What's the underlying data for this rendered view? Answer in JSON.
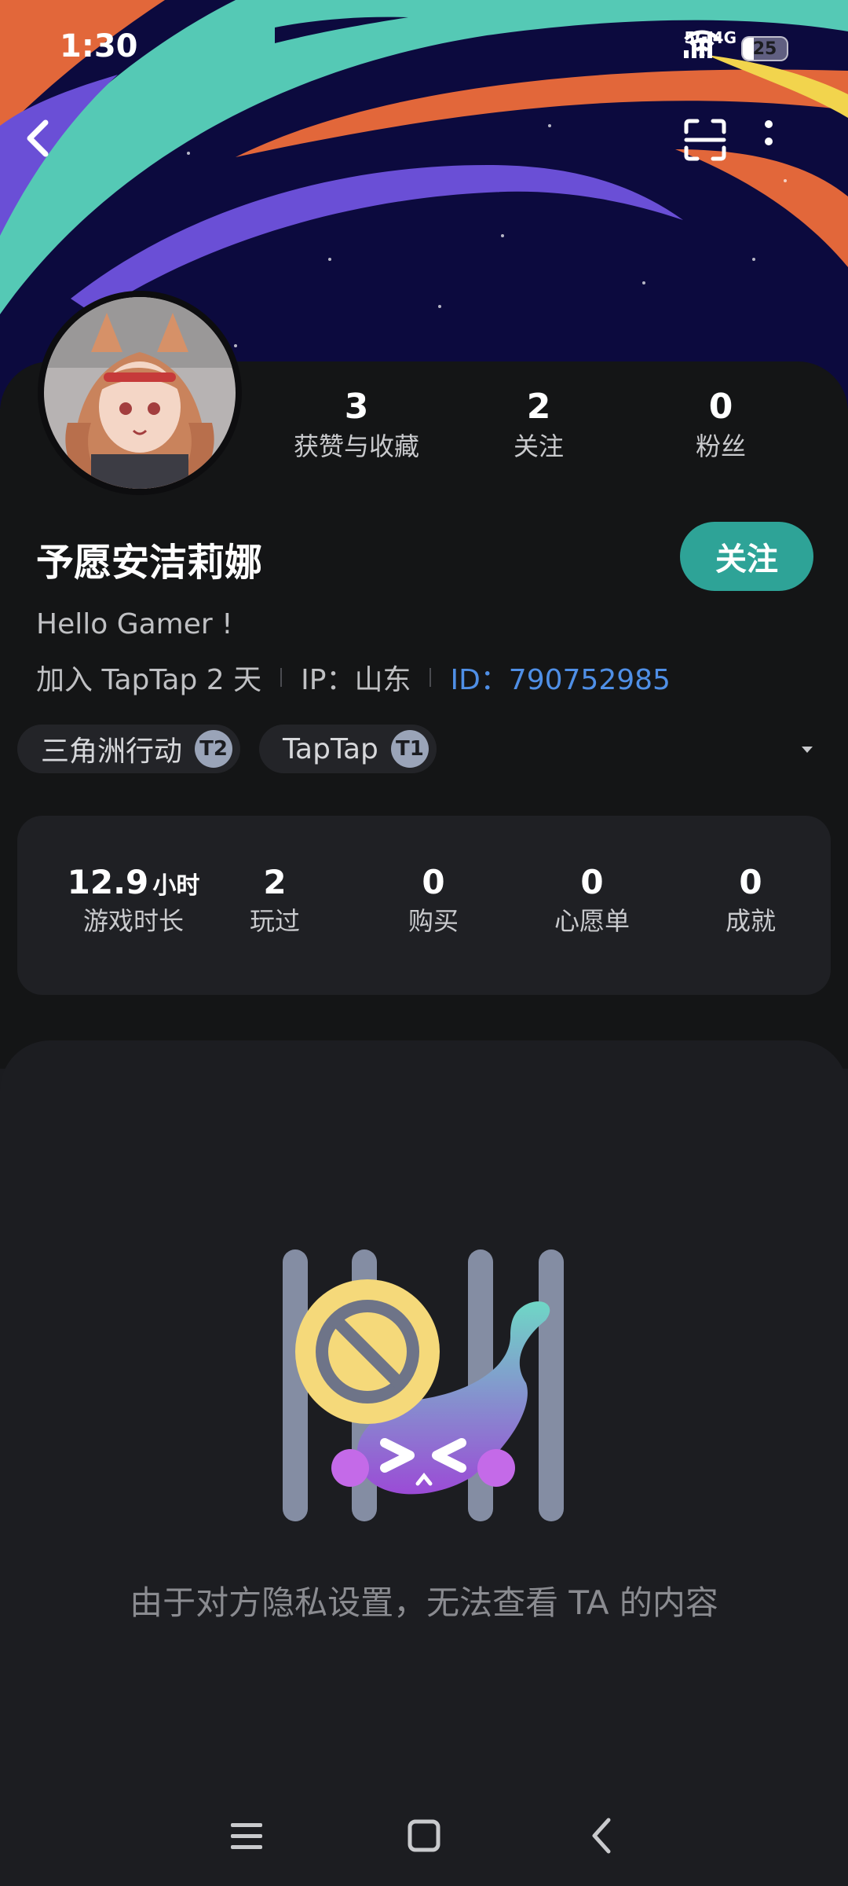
{
  "status_bar": {
    "time": "1:30",
    "network_1": "5G",
    "network_2": "4G",
    "battery": "25",
    "battery_level": 0.25
  },
  "nav": {
    "back_icon": "chevron-left-icon",
    "scan_icon": "scan-icon",
    "more_icon": "more-vertical-icon"
  },
  "profile": {
    "name": "予愿安洁莉娜",
    "follow_label": "关注",
    "bio": "Hello Gamer !",
    "joined": "加入 TapTap 2 天",
    "ip": "IP：山东",
    "id": "ID：790752985",
    "stats": [
      {
        "value": "3",
        "label": "获赞与收藏"
      },
      {
        "value": "2",
        "label": "关注"
      },
      {
        "value": "0",
        "label": "粉丝"
      }
    ],
    "tags": [
      {
        "label": "三角洲行动",
        "badge": "T2"
      },
      {
        "label": "TapTap",
        "badge": "T1"
      }
    ]
  },
  "game_stats": [
    {
      "value": "12.9",
      "unit": "小时",
      "label": "游戏时长"
    },
    {
      "value": "2",
      "unit": "",
      "label": "玩过"
    },
    {
      "value": "0",
      "unit": "",
      "label": "购买"
    },
    {
      "value": "0",
      "unit": "",
      "label": "心愿单"
    },
    {
      "value": "0",
      "unit": "",
      "label": "成就"
    }
  ],
  "private": {
    "message": "由于对方隐私设置，无法查看 TA 的内容"
  },
  "colors": {
    "accent": "#2ea397",
    "id_blue": "#4f8fe6",
    "background": "#1b1c20"
  }
}
